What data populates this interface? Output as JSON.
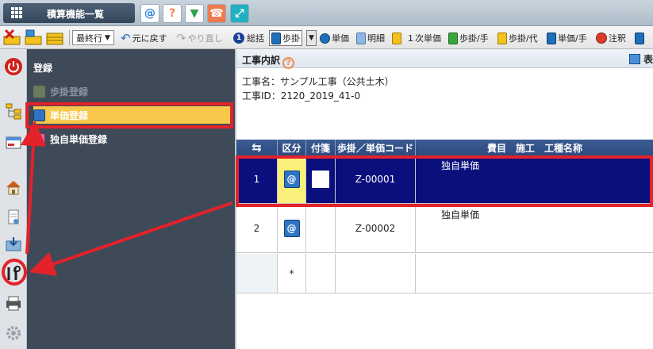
{
  "titlebar": {
    "menu_label": "積算機能一覧",
    "icons": [
      {
        "name": "at-icon",
        "glyph": "@",
        "color": "#2a7fd4"
      },
      {
        "name": "help-icon",
        "glyph": "?",
        "color": "#f08a4b"
      },
      {
        "name": "beginner-icon",
        "glyph": "▼",
        "color": "#2aa34a"
      },
      {
        "name": "support-icon",
        "glyph": "☎",
        "color": "#f07a50"
      },
      {
        "name": "resize-icon",
        "glyph": "⤢",
        "color": "#20b0c0"
      }
    ]
  },
  "toolbar": {
    "last_row_select": "最終行",
    "undo_label": "元に戻す",
    "redo_label": "やり直し",
    "summary_label": "総括",
    "summary_badge": "1",
    "bukake_label": "歩掛",
    "tanka_label": "単価",
    "meisai_label": "明細",
    "ichiji_tanka_label": "１次単価",
    "bukake_te_label": "歩掛/手",
    "bukake_dai_label": "歩掛/代",
    "tanka_te_label": "単価/手",
    "chuki_label": "注釈"
  },
  "nav": {
    "title": "登録",
    "items": [
      {
        "label": "歩掛登録",
        "state": "disabled"
      },
      {
        "label": "単価登録",
        "state": "active"
      },
      {
        "label": "独自単価登録",
        "state": "normal"
      }
    ]
  },
  "main": {
    "title": "工事内訳",
    "right_label": "表",
    "project_name": "工事名：サンプル工事（公共土木）",
    "project_id": "工事ID：2120_2019_41-0"
  },
  "table": {
    "headers": {
      "move": "⇆",
      "kubun": "区分",
      "fusen": "付箋",
      "code": "歩掛／単価コード",
      "name": "費目　施工　工種名称"
    },
    "rows": [
      {
        "no": "1",
        "code": "Z-00001",
        "name": "独自単価",
        "selected": true
      },
      {
        "no": "2",
        "code": "Z-00002",
        "name": "独自単価",
        "selected": false
      }
    ],
    "new_row_marker": "*"
  },
  "colors": {
    "accent_red": "#e3222a",
    "selected_row": "#0a0f7d",
    "nav_bg": "#3f4a59",
    "nav_active": "#f7c84a",
    "header_blue": "#2e4b80"
  }
}
